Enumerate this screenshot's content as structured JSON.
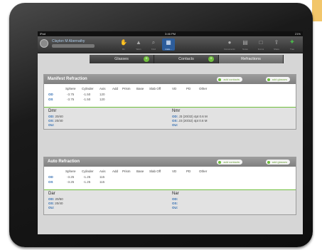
{
  "status": {
    "left": "iPad",
    "time": "3:46 PM",
    "battery": "21%"
  },
  "patient": {
    "name": "Clayton M Abernathy"
  },
  "nav": {
    "items": [
      {
        "label": "Rx",
        "icon": "hand-icon"
      },
      {
        "label": "Warn",
        "icon": "warning-icon"
      },
      {
        "label": "Find",
        "icon": "search-icon"
      },
      {
        "label": "more...",
        "icon": "grid-icon"
      }
    ],
    "right_items": [
      {
        "label": "Documents",
        "icon": "person-icon"
      },
      {
        "label": "Notes",
        "icon": "notes-icon"
      },
      {
        "label": "Forms",
        "icon": "form-icon"
      },
      {
        "label": "Share",
        "icon": "share-icon"
      },
      {
        "label": "Tree",
        "icon": "tree-icon"
      }
    ]
  },
  "tabs": [
    {
      "label": "Glasses"
    },
    {
      "label": "Contacts"
    },
    {
      "label": "Refractions"
    }
  ],
  "buttons": {
    "add_contacts": "add contacts",
    "add_glasses": "add glasses"
  },
  "columns": [
    "Sphere",
    "Cylinder",
    "Axis",
    "Add",
    "Prism",
    "Base",
    "Slab Off",
    "VD",
    "PD",
    "Other"
  ],
  "manifest": {
    "title": "Manifest Refraction",
    "rows": [
      {
        "eye": "OD",
        "sphere": "-3.75",
        "cylinder": "-1.50",
        "axis": "120"
      },
      {
        "eye": "OS",
        "sphere": "-3.75",
        "cylinder": "-1.50",
        "axis": "120"
      }
    ],
    "left": {
      "title": "Dmr",
      "lines": [
        [
          "OD:",
          "20/40"
        ],
        [
          "OS:",
          "20/40"
        ],
        [
          "OU:",
          ""
        ]
      ]
    },
    "right": {
      "title": "Nmr",
      "lines": [
        [
          "OD:",
          "J3 (20/32) 4pt 0.6 M"
        ],
        [
          "OS:",
          "J3 (20/32) 4pt 0.6 M"
        ],
        [
          "OU:",
          ""
        ]
      ]
    }
  },
  "auto": {
    "title": "Auto Refraction",
    "rows": [
      {
        "eye": "OD",
        "sphere": "-3.25",
        "cylinder": "-1.25",
        "axis": "115"
      },
      {
        "eye": "OS",
        "sphere": "-3.25",
        "cylinder": "-1.25",
        "axis": "115"
      }
    ],
    "left": {
      "title": "Dar",
      "lines": [
        [
          "OD:",
          "20/50"
        ],
        [
          "OS:",
          "20/40"
        ],
        [
          "OU:",
          ""
        ]
      ]
    },
    "right": {
      "title": "Nar",
      "lines": [
        [
          "OD:",
          ""
        ],
        [
          "OS:",
          ""
        ],
        [
          "OU:",
          ""
        ]
      ]
    }
  }
}
